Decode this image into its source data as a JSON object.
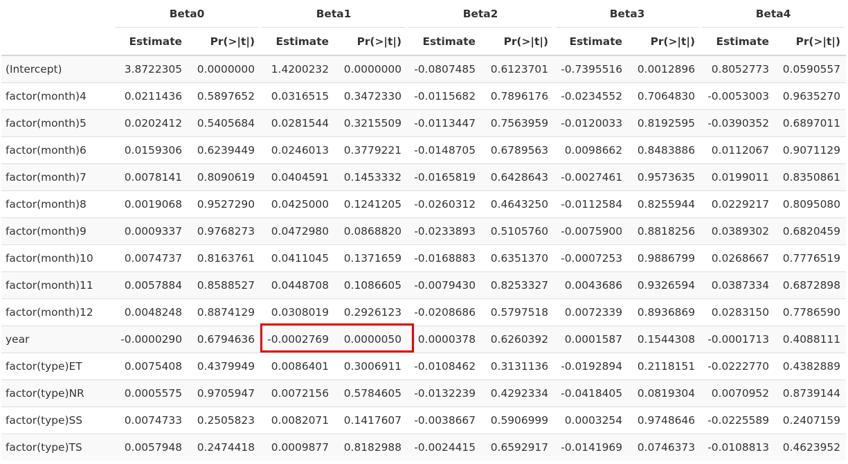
{
  "table": {
    "groups": [
      "Beta0",
      "Beta1",
      "Beta2",
      "Beta3",
      "Beta4"
    ],
    "subheaders": [
      "Estimate",
      "Pr(>|t|)"
    ],
    "rows": [
      {
        "label": "(Intercept)",
        "values": [
          "3.8722305",
          "0.0000000",
          "1.4200232",
          "0.0000000",
          "-0.0807485",
          "0.6123701",
          "-0.7395516",
          "0.0012896",
          "0.8052773",
          "0.0590557"
        ]
      },
      {
        "label": "factor(month)4",
        "values": [
          "0.0211436",
          "0.5897652",
          "0.0316515",
          "0.3472330",
          "-0.0115682",
          "0.7896176",
          "-0.0234552",
          "0.7064830",
          "-0.0053003",
          "0.9635270"
        ]
      },
      {
        "label": "factor(month)5",
        "values": [
          "0.0202412",
          "0.5405684",
          "0.0281544",
          "0.3215509",
          "-0.0113447",
          "0.7563959",
          "-0.0120033",
          "0.8192595",
          "-0.0390352",
          "0.6897011"
        ]
      },
      {
        "label": "factor(month)6",
        "values": [
          "0.0159306",
          "0.6239449",
          "0.0246013",
          "0.3779221",
          "-0.0148705",
          "0.6789563",
          "0.0098662",
          "0.8483886",
          "0.0112067",
          "0.9071129"
        ]
      },
      {
        "label": "factor(month)7",
        "values": [
          "0.0078141",
          "0.8090619",
          "0.0404591",
          "0.1453332",
          "-0.0165819",
          "0.6428643",
          "-0.0027461",
          "0.9573635",
          "0.0199011",
          "0.8350861"
        ]
      },
      {
        "label": "factor(month)8",
        "values": [
          "0.0019068",
          "0.9527290",
          "0.0425000",
          "0.1241205",
          "-0.0260312",
          "0.4643250",
          "-0.0112584",
          "0.8255944",
          "0.0229217",
          "0.8095080"
        ]
      },
      {
        "label": "factor(month)9",
        "values": [
          "0.0009337",
          "0.9768273",
          "0.0472980",
          "0.0868820",
          "-0.0233893",
          "0.5105760",
          "-0.0075900",
          "0.8818256",
          "0.0389302",
          "0.6820459"
        ]
      },
      {
        "label": "factor(month)10",
        "values": [
          "0.0074737",
          "0.8163761",
          "0.0411045",
          "0.1371659",
          "-0.0168883",
          "0.6351370",
          "-0.0007253",
          "0.9886799",
          "0.0268667",
          "0.7776519"
        ]
      },
      {
        "label": "factor(month)11",
        "values": [
          "0.0057884",
          "0.8588527",
          "0.0448708",
          "0.1086605",
          "-0.0079430",
          "0.8253327",
          "0.0043686",
          "0.9326594",
          "0.0387334",
          "0.6872898"
        ]
      },
      {
        "label": "factor(month)12",
        "values": [
          "0.0048248",
          "0.8874129",
          "0.0308019",
          "0.2926123",
          "-0.0208686",
          "0.5797518",
          "0.0072339",
          "0.8936869",
          "0.0283150",
          "0.7786590"
        ]
      },
      {
        "label": "year",
        "values": [
          "-0.0000290",
          "0.6794636",
          "-0.0002769",
          "0.0000050",
          "0.0000378",
          "0.6260392",
          "0.0001587",
          "0.1544308",
          "-0.0001713",
          "0.4088111"
        ]
      },
      {
        "label": "factor(type)ET",
        "values": [
          "0.0075408",
          "0.4379949",
          "0.0086401",
          "0.3006911",
          "-0.0108462",
          "0.3131136",
          "-0.0192894",
          "0.2118151",
          "-0.0222770",
          "0.4382889"
        ]
      },
      {
        "label": "factor(type)NR",
        "values": [
          "0.0005575",
          "0.9705947",
          "0.0072156",
          "0.5784605",
          "-0.0132239",
          "0.4292334",
          "-0.0418405",
          "0.0819304",
          "0.0070952",
          "0.8739144"
        ]
      },
      {
        "label": "factor(type)SS",
        "values": [
          "0.0074733",
          "0.2505823",
          "0.0082071",
          "0.1417607",
          "-0.0038667",
          "0.5906999",
          "0.0003254",
          "0.9748646",
          "-0.0225589",
          "0.2407159"
        ]
      },
      {
        "label": "factor(type)TS",
        "values": [
          "0.0057948",
          "0.2474418",
          "0.0009877",
          "0.8182988",
          "-0.0024415",
          "0.6592917",
          "-0.0141969",
          "0.0746373",
          "-0.0108813",
          "0.4623952"
        ]
      }
    ]
  },
  "highlight": {
    "row": "year",
    "group": "Beta1",
    "color": "#e10600"
  }
}
